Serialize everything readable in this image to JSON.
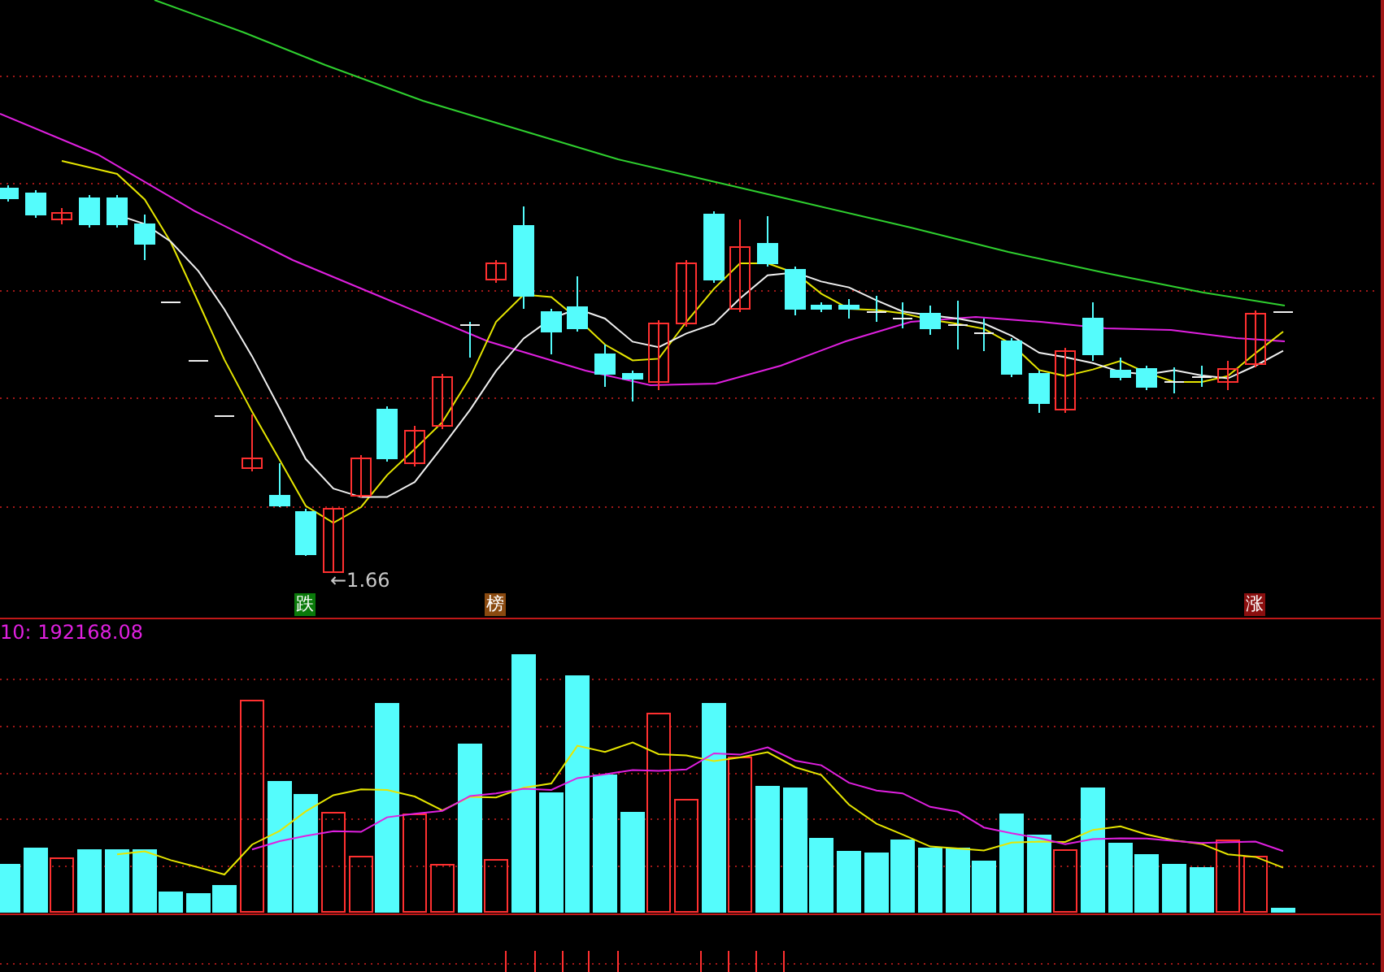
{
  "price_panel": {
    "low_label": "←1.66",
    "markers": [
      {
        "label": "跌",
        "color": "#0a7a0a"
      },
      {
        "label": "榜",
        "color": "#8a4a10"
      },
      {
        "label": "涨",
        "color": "#8b0f0f"
      }
    ]
  },
  "volume_panel": {
    "legend": "10: 192168.08"
  }
}
